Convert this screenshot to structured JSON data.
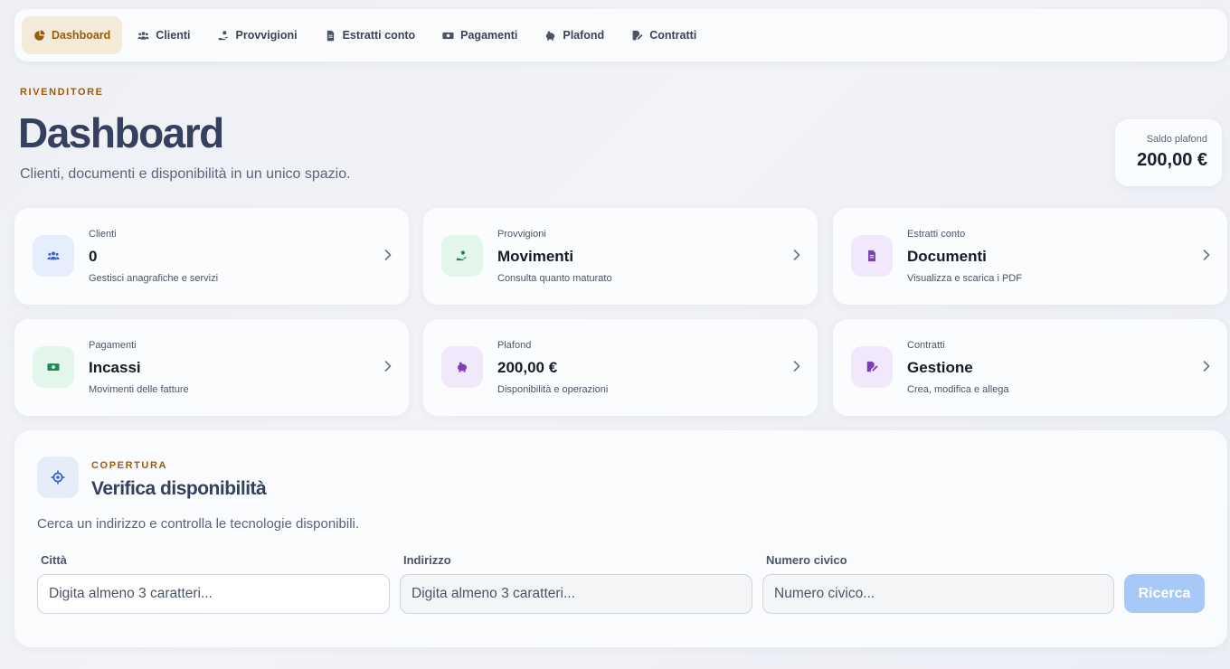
{
  "nav": {
    "items": [
      {
        "label": "Dashboard",
        "icon": "chart-pie-icon",
        "active": true
      },
      {
        "label": "Clienti",
        "icon": "users-icon",
        "active": false
      },
      {
        "label": "Provvigioni",
        "icon": "hand-coin-icon",
        "active": false
      },
      {
        "label": "Estratti conto",
        "icon": "file-invoice-icon",
        "active": false
      },
      {
        "label": "Pagamenti",
        "icon": "money-bill-icon",
        "active": false
      },
      {
        "label": "Plafond",
        "icon": "piggy-bank-icon",
        "active": false
      },
      {
        "label": "Contratti",
        "icon": "file-signature-icon",
        "active": false
      }
    ]
  },
  "header": {
    "eyebrow": "RIVENDITORE",
    "title": "Dashboard",
    "subtitle": "Clienti, documenti e disponibilità in un unico spazio."
  },
  "saldo": {
    "label": "Saldo plafond",
    "value": "200,00 €"
  },
  "cards": [
    {
      "label": "Clienti",
      "value": "0",
      "desc": "Gestisci anagrafiche e servizi",
      "icon": "users-icon",
      "icon_bg": "#e6edfc",
      "icon_color": "#3b62c4"
    },
    {
      "label": "Provvigioni",
      "value": "Movimenti",
      "desc": "Consulta quanto maturato",
      "icon": "hand-coin-icon",
      "icon_bg": "#e3f6ec",
      "icon_color": "#1f8a52"
    },
    {
      "label": "Estratti conto",
      "value": "Documenti",
      "desc": "Visualizza e scarica i PDF",
      "icon": "file-invoice-icon",
      "icon_bg": "#f1e8fb",
      "icon_color": "#7b3fb8"
    },
    {
      "label": "Pagamenti",
      "value": "Incassi",
      "desc": "Movimenti delle fatture",
      "icon": "money-bill-icon",
      "icon_bg": "#e3f6ec",
      "icon_color": "#1f8a52"
    },
    {
      "label": "Plafond",
      "value": "200,00 €",
      "desc": "Disponibilità e operazioni",
      "icon": "piggy-bank-icon",
      "icon_bg": "#f1e8fb",
      "icon_color": "#7b3fb8"
    },
    {
      "label": "Contratti",
      "value": "Gestione",
      "desc": "Crea, modifica e allega",
      "icon": "file-signature-icon",
      "icon_bg": "#f1e8fb",
      "icon_color": "#7b3fb8"
    }
  ],
  "coverage": {
    "eyebrow": "COPERTURA",
    "title": "Verifica disponibilità",
    "subtitle": "Cerca un indirizzo e controlla le tecnologie disponibili.",
    "city_label": "Città",
    "city_placeholder": "Digita almeno 3 caratteri...",
    "address_label": "Indirizzo",
    "address_placeholder": "Digita almeno 3 caratteri...",
    "number_label": "Numero civico",
    "number_placeholder": "Numero civico...",
    "search_label": "Ricerca"
  },
  "colors": {
    "accent": "#a05a0a",
    "title": "#34405e",
    "active_nav_bg": "#f3ead8",
    "search_button": "#a8c8f8"
  }
}
